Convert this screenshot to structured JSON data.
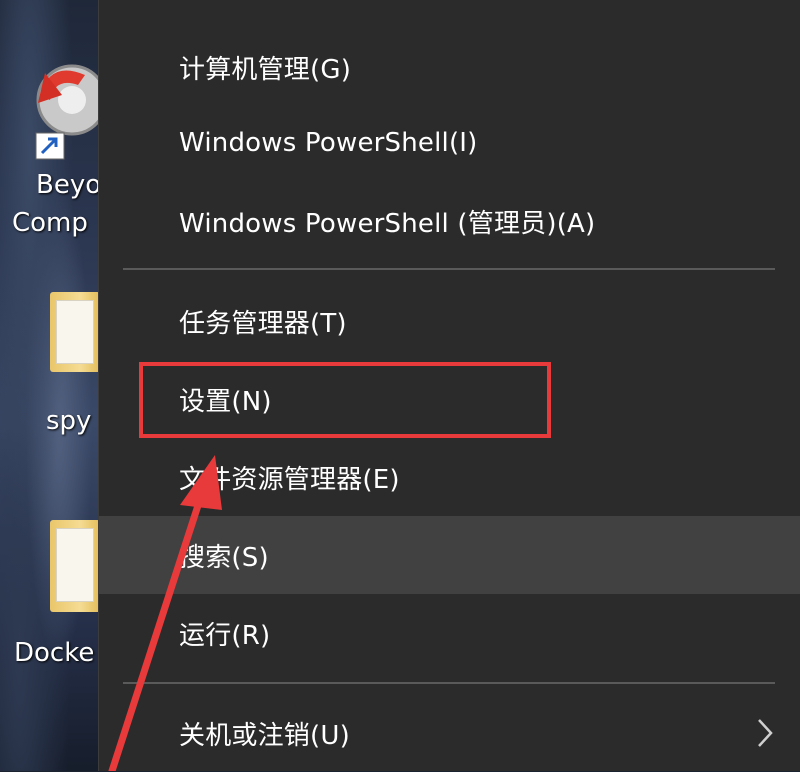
{
  "desktop": {
    "icons": [
      {
        "name": "beyond-compare",
        "label_line1": "Beyo",
        "label_line2": "Comp"
      },
      {
        "name": "spy-folder",
        "label_line1": "spy"
      },
      {
        "name": "docker-folder",
        "label_line1": "Docke"
      }
    ]
  },
  "menu": {
    "items": [
      {
        "label": "计算机管理(G)"
      },
      {
        "label": "Windows PowerShell(I)"
      },
      {
        "label": "Windows PowerShell (管理员)(A)"
      },
      {
        "label": "任务管理器(T)"
      },
      {
        "label": "设置(N)"
      },
      {
        "label": "文件资源管理器(E)"
      },
      {
        "label": "搜索(S)"
      },
      {
        "label": "运行(R)"
      },
      {
        "label": "关机或注销(U)"
      }
    ],
    "hovered_item": "搜索(S)",
    "submenu_icon": "chevron-right-icon"
  },
  "annotation": {
    "highlight_color": "#e83a3a",
    "highlighted_item": "设置(N)"
  },
  "colors": {
    "menu_background": "#2b2b2b",
    "hover_background": "#414141",
    "separator": "#5a5a5a",
    "text": "#ffffff"
  }
}
